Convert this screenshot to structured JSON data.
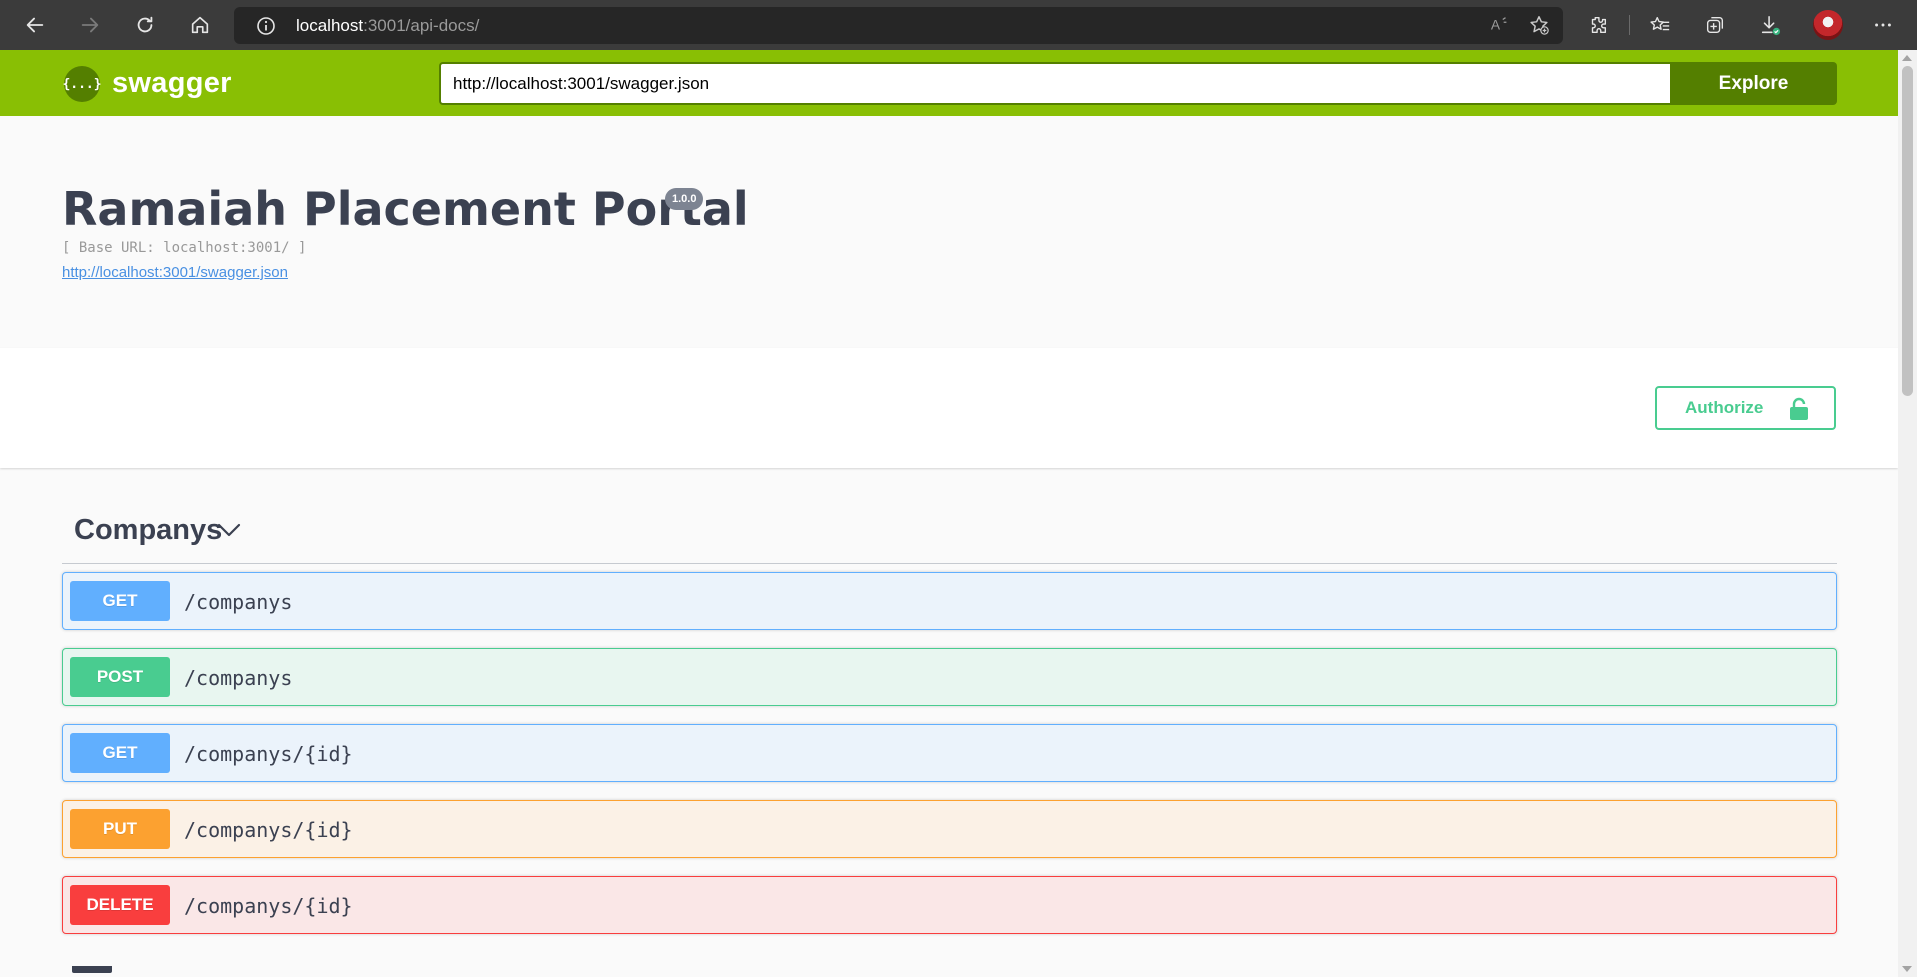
{
  "browser": {
    "url_host": "localhost",
    "url_rest": ":3001/api-docs/",
    "icons": [
      "back-icon",
      "forward-icon",
      "refresh-icon",
      "home-icon",
      "site-info-icon",
      "read-aloud-icon",
      "add-favorite-icon",
      "extensions-icon",
      "favorites-icon",
      "collections-icon",
      "downloads-icon",
      "profile-avatar",
      "more-icon"
    ]
  },
  "topbar": {
    "logo_icon_text": "{...}",
    "logo_text": "swagger",
    "spec_url": "http://localhost:3001/swagger.json",
    "explore_label": "Explore",
    "colors": {
      "bar": "#89bf04",
      "dark": "#547f00"
    }
  },
  "info": {
    "title": "Ramaiah Placement Portal",
    "version": "1.0.0",
    "base_url": "[ Base URL: localhost:3001/ ]",
    "spec_link": "http://localhost:3001/swagger.json"
  },
  "auth": {
    "label": "Authorize",
    "color": "#49cc90"
  },
  "tag": {
    "name": "Companys",
    "expanded": true
  },
  "operations": [
    {
      "method": "GET",
      "path": "/companys",
      "color": "#61affe"
    },
    {
      "method": "POST",
      "path": "/companys",
      "color": "#49cc90"
    },
    {
      "method": "GET",
      "path": "/companys/{id}",
      "color": "#61affe"
    },
    {
      "method": "PUT",
      "path": "/companys/{id}",
      "color": "#fca130"
    },
    {
      "method": "DELETE",
      "path": "/companys/{id}",
      "color": "#f93e3e"
    }
  ]
}
